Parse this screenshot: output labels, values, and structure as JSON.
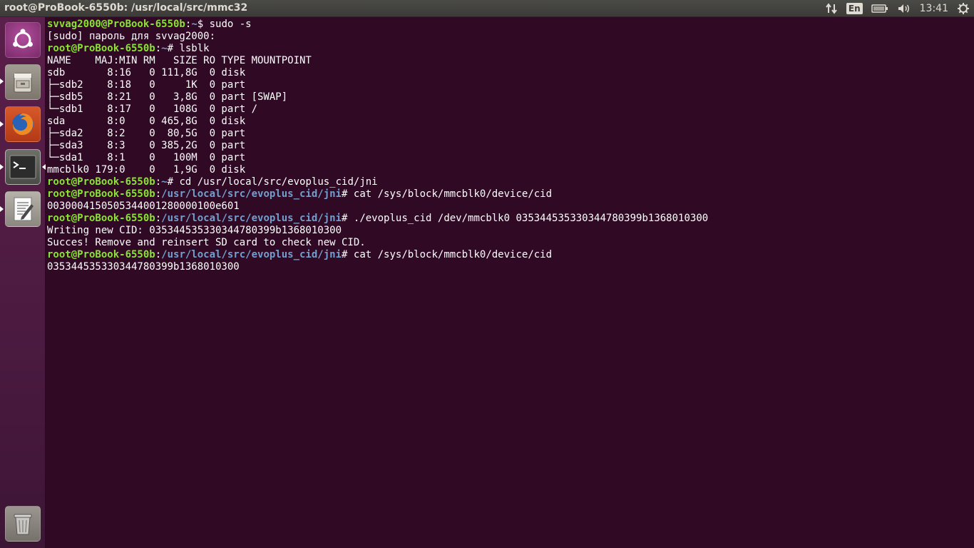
{
  "top_panel": {
    "window_title": "root@ProBook-6550b: /usr/local/src/mmc32",
    "keyboard_layout": "En",
    "clock": "13:41",
    "icons": [
      "network-transfer-icon",
      "keyboard-layout-icon",
      "battery-icon",
      "volume-icon",
      "gear-icon"
    ]
  },
  "launcher": {
    "items": [
      "ubuntu-dash-icon",
      "files-icon",
      "firefox-icon",
      "terminal-icon",
      "text-editor-icon",
      "trash-icon"
    ]
  },
  "terminal": {
    "lines": [
      {
        "user": "svvag2000@ProBook-6550b",
        "sep": ":",
        "path": "~",
        "prompt": "$ ",
        "cmd": "sudo -s"
      },
      {
        "text": "[sudo] пароль для svvag2000:"
      },
      {
        "user": "root@ProBook-6550b",
        "sep": ":",
        "path": "~",
        "prompt": "# ",
        "cmd": "lsblk"
      },
      {
        "text": "NAME    MAJ:MIN RM   SIZE RO TYPE MOUNTPOINT"
      },
      {
        "text": "sdb       8:16   0 111,8G  0 disk"
      },
      {
        "text": "├─sdb2    8:18   0     1K  0 part"
      },
      {
        "text": "├─sdb5    8:21   0   3,8G  0 part [SWAP]"
      },
      {
        "text": "└─sdb1    8:17   0   108G  0 part /"
      },
      {
        "text": "sda       8:0    0 465,8G  0 disk"
      },
      {
        "text": "├─sda2    8:2    0  80,5G  0 part"
      },
      {
        "text": "├─sda3    8:3    0 385,2G  0 part"
      },
      {
        "text": "└─sda1    8:1    0   100M  0 part"
      },
      {
        "text": "mmcblk0 179:0    0   1,9G  0 disk"
      },
      {
        "user": "root@ProBook-6550b",
        "sep": ":",
        "path": "~",
        "prompt": "# ",
        "cmd": "cd /usr/local/src/evoplus_cid/jni"
      },
      {
        "user": "root@ProBook-6550b",
        "sep": ":",
        "path": "/usr/local/src/evoplus_cid/jni",
        "prompt": "# ",
        "cmd": "cat /sys/block/mmcblk0/device/cid"
      },
      {
        "text": "0030004150505344001280000100e601"
      },
      {
        "user": "root@ProBook-6550b",
        "sep": ":",
        "path": "/usr/local/src/evoplus_cid/jni",
        "prompt": "# ",
        "cmd": "./evoplus_cid /dev/mmcblk0 035344535330344780399b1368010300"
      },
      {
        "text": "Writing new CID: 035344535330344780399b1368010300"
      },
      {
        "text": "Succes! Remove and reinsert SD card to check new CID."
      },
      {
        "user": "root@ProBook-6550b",
        "sep": ":",
        "path": "/usr/local/src/evoplus_cid/jni",
        "prompt": "# ",
        "cmd": "cat /sys/block/mmcblk0/device/cid"
      },
      {
        "text": "035344535330344780399b1368010300"
      }
    ]
  },
  "colors": {
    "terminal_bg": "#300a24",
    "prompt_user": "#8ae234",
    "prompt_path": "#729fcf",
    "panel_bg": "#3c3b37"
  }
}
